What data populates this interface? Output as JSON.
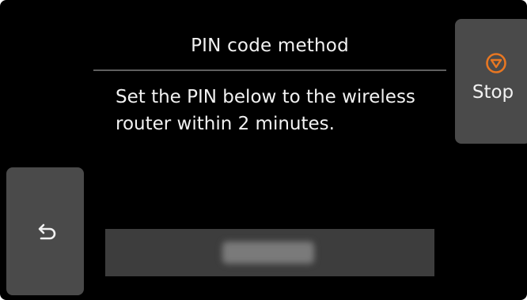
{
  "header": {
    "title": "PIN code method"
  },
  "main": {
    "message_line1": "Set the PIN below to the wireless",
    "message_line2": "router within 2 minutes."
  },
  "stop_button": {
    "label": "Stop",
    "icon": "stop-icon",
    "accent_color": "#e87722"
  },
  "back_button": {
    "icon": "back-arrow-icon"
  },
  "colors": {
    "background": "#000000",
    "button": "#4a4a4a",
    "text": "#f2f2f2"
  }
}
